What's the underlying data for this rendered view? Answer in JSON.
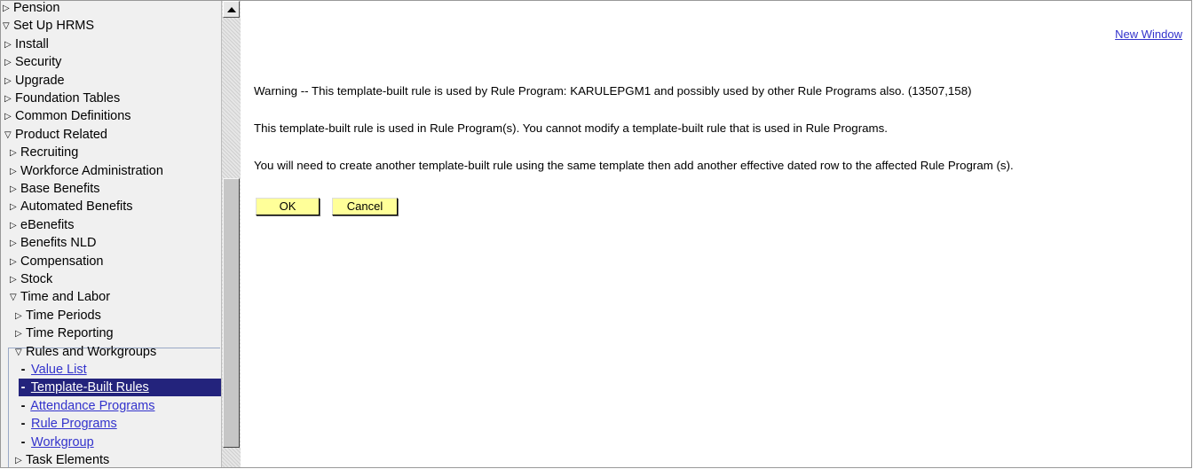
{
  "nav": {
    "items": [
      {
        "label": "Pension",
        "state": "collapsed",
        "level": 0
      },
      {
        "label": "Set Up HRMS",
        "state": "expanded",
        "level": 0
      },
      {
        "label": "Install",
        "state": "collapsed",
        "level": 1
      },
      {
        "label": "Security",
        "state": "collapsed",
        "level": 1
      },
      {
        "label": "Upgrade",
        "state": "collapsed",
        "level": 1
      },
      {
        "label": "Foundation Tables",
        "state": "collapsed",
        "level": 1
      },
      {
        "label": "Common Definitions",
        "state": "collapsed",
        "level": 1
      },
      {
        "label": "Product Related",
        "state": "expanded",
        "level": 1
      },
      {
        "label": "Recruiting",
        "state": "collapsed",
        "level": 2
      },
      {
        "label": "Workforce Administration",
        "state": "collapsed",
        "level": 2
      },
      {
        "label": "Base Benefits",
        "state": "collapsed",
        "level": 2
      },
      {
        "label": "Automated Benefits",
        "state": "collapsed",
        "level": 2
      },
      {
        "label": "eBenefits",
        "state": "collapsed",
        "level": 2
      },
      {
        "label": "Benefits NLD",
        "state": "collapsed",
        "level": 2
      },
      {
        "label": "Compensation",
        "state": "collapsed",
        "level": 2
      },
      {
        "label": "Stock",
        "state": "collapsed",
        "level": 2
      },
      {
        "label": "Time and Labor",
        "state": "expanded",
        "level": 2
      },
      {
        "label": "Time Periods",
        "state": "collapsed",
        "level": 3
      },
      {
        "label": "Time Reporting",
        "state": "collapsed",
        "level": 3
      },
      {
        "label": "Rules and Workgroups",
        "state": "expanded",
        "level": 3
      },
      {
        "label": "Value List",
        "state": "link",
        "level": 4
      },
      {
        "label": "Template-Built Rules",
        "state": "selected",
        "level": 4
      },
      {
        "label": "Attendance Programs",
        "state": "link",
        "level": 4
      },
      {
        "label": "Rule Programs",
        "state": "link",
        "level": 4
      },
      {
        "label": "Workgroup",
        "state": "link",
        "level": 4
      },
      {
        "label": "Task Elements",
        "state": "collapsed",
        "level": 3
      }
    ]
  },
  "main": {
    "new_window": "New Window",
    "warning": "Warning -- This template-built rule is used by Rule Program: KARULEPGM1 and possibly used by other Rule Programs also. (13507,158)",
    "info": "This template-built rule is used in Rule Program(s). You cannot modify a template-built rule that is used in Rule Programs.",
    "instruction": "You will need to create another template-built rule using the same template then add another effective dated row to the affected Rule Program (s).",
    "ok_label": "OK",
    "cancel_label": "Cancel"
  },
  "colors": {
    "nav_background": "#f0f0f0",
    "selected_background": "#23237c",
    "link": "#3333cc",
    "button": "#ffff99"
  }
}
